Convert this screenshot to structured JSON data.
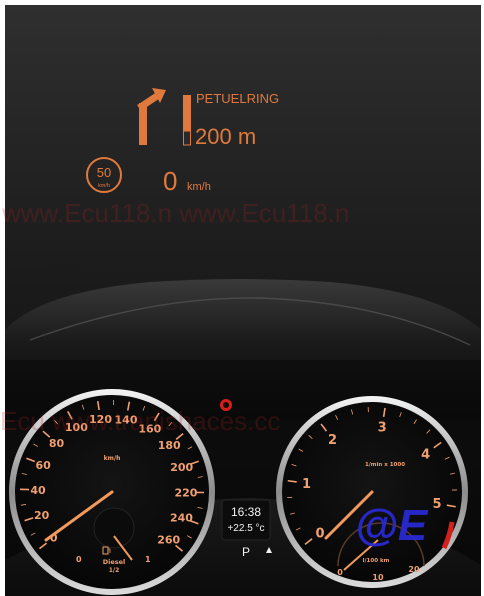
{
  "hud": {
    "street_name": "PETUELRING",
    "distance": "200 m",
    "speed_limit": "50",
    "speed_limit_unit": "km/h",
    "current_speed": "0",
    "current_speed_unit": "km/h"
  },
  "watermarks": {
    "hud_text": "www.Ecu118.n    www.Ecu118.n",
    "cluster_text": "Ecu    www.tranishaces.cc"
  },
  "speedometer": {
    "unit": "km/h",
    "ticks": [
      "0",
      "20",
      "40",
      "60",
      "80",
      "100",
      "120",
      "140",
      "160",
      "180",
      "200",
      "220",
      "240",
      "260"
    ],
    "fuel_type": "Diesel",
    "fuel_fraction": "1/2",
    "fuel_left": "0",
    "fuel_right": "1",
    "needle_value": 0
  },
  "tachometer": {
    "unit": "1/min x 1000",
    "ticks": [
      "0",
      "1",
      "2",
      "3",
      "4",
      "5"
    ],
    "eco_unit": "l/100 km",
    "eco_ticks": [
      "0",
      "10",
      "20"
    ],
    "needle_value": 0
  },
  "center_display": {
    "time": "16:38",
    "temperature": "+22.5 °c",
    "gear": "P"
  },
  "logo": {
    "text": "@E"
  },
  "colors": {
    "hud_orange": "#e07a3c",
    "dial_label": "#f0a070",
    "warning_red": "#d4201a",
    "logo_blue": "#2a2ad8"
  }
}
